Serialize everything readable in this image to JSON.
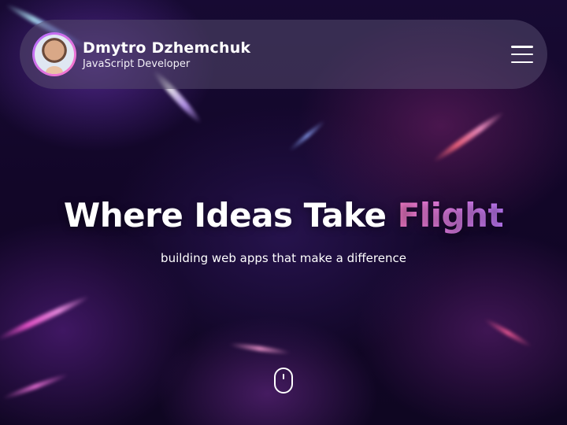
{
  "header": {
    "name": "Dmytro Dzhemchuk",
    "role": "JavaScript Developer",
    "avatar_icon": "profile-photo",
    "menu_icon": "hamburger-menu-icon"
  },
  "hero": {
    "title_main": "Where Ideas Take ",
    "title_accent": "Flight",
    "subtitle": "building web apps that make a difference",
    "scroll_icon": "mouse-scroll-icon"
  },
  "colors": {
    "accent_start": "#ff7fd0",
    "accent_end": "#c37cff",
    "header_bg": "rgba(85,75,110,0.55)"
  }
}
